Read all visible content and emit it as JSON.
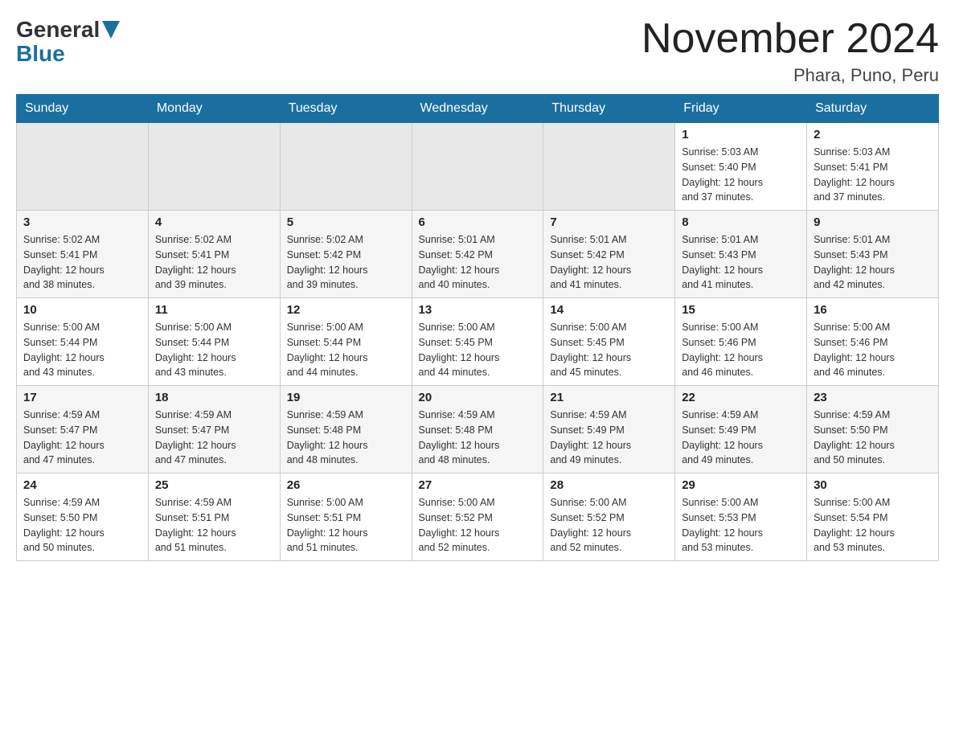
{
  "logo": {
    "text_general": "General",
    "text_blue": "Blue"
  },
  "title": "November 2024",
  "subtitle": "Phara, Puno, Peru",
  "days_of_week": [
    "Sunday",
    "Monday",
    "Tuesday",
    "Wednesday",
    "Thursday",
    "Friday",
    "Saturday"
  ],
  "weeks": [
    [
      {
        "day": "",
        "info": ""
      },
      {
        "day": "",
        "info": ""
      },
      {
        "day": "",
        "info": ""
      },
      {
        "day": "",
        "info": ""
      },
      {
        "day": "",
        "info": ""
      },
      {
        "day": "1",
        "info": "Sunrise: 5:03 AM\nSunset: 5:40 PM\nDaylight: 12 hours\nand 37 minutes."
      },
      {
        "day": "2",
        "info": "Sunrise: 5:03 AM\nSunset: 5:41 PM\nDaylight: 12 hours\nand 37 minutes."
      }
    ],
    [
      {
        "day": "3",
        "info": "Sunrise: 5:02 AM\nSunset: 5:41 PM\nDaylight: 12 hours\nand 38 minutes."
      },
      {
        "day": "4",
        "info": "Sunrise: 5:02 AM\nSunset: 5:41 PM\nDaylight: 12 hours\nand 39 minutes."
      },
      {
        "day": "5",
        "info": "Sunrise: 5:02 AM\nSunset: 5:42 PM\nDaylight: 12 hours\nand 39 minutes."
      },
      {
        "day": "6",
        "info": "Sunrise: 5:01 AM\nSunset: 5:42 PM\nDaylight: 12 hours\nand 40 minutes."
      },
      {
        "day": "7",
        "info": "Sunrise: 5:01 AM\nSunset: 5:42 PM\nDaylight: 12 hours\nand 41 minutes."
      },
      {
        "day": "8",
        "info": "Sunrise: 5:01 AM\nSunset: 5:43 PM\nDaylight: 12 hours\nand 41 minutes."
      },
      {
        "day": "9",
        "info": "Sunrise: 5:01 AM\nSunset: 5:43 PM\nDaylight: 12 hours\nand 42 minutes."
      }
    ],
    [
      {
        "day": "10",
        "info": "Sunrise: 5:00 AM\nSunset: 5:44 PM\nDaylight: 12 hours\nand 43 minutes."
      },
      {
        "day": "11",
        "info": "Sunrise: 5:00 AM\nSunset: 5:44 PM\nDaylight: 12 hours\nand 43 minutes."
      },
      {
        "day": "12",
        "info": "Sunrise: 5:00 AM\nSunset: 5:44 PM\nDaylight: 12 hours\nand 44 minutes."
      },
      {
        "day": "13",
        "info": "Sunrise: 5:00 AM\nSunset: 5:45 PM\nDaylight: 12 hours\nand 44 minutes."
      },
      {
        "day": "14",
        "info": "Sunrise: 5:00 AM\nSunset: 5:45 PM\nDaylight: 12 hours\nand 45 minutes."
      },
      {
        "day": "15",
        "info": "Sunrise: 5:00 AM\nSunset: 5:46 PM\nDaylight: 12 hours\nand 46 minutes."
      },
      {
        "day": "16",
        "info": "Sunrise: 5:00 AM\nSunset: 5:46 PM\nDaylight: 12 hours\nand 46 minutes."
      }
    ],
    [
      {
        "day": "17",
        "info": "Sunrise: 4:59 AM\nSunset: 5:47 PM\nDaylight: 12 hours\nand 47 minutes."
      },
      {
        "day": "18",
        "info": "Sunrise: 4:59 AM\nSunset: 5:47 PM\nDaylight: 12 hours\nand 47 minutes."
      },
      {
        "day": "19",
        "info": "Sunrise: 4:59 AM\nSunset: 5:48 PM\nDaylight: 12 hours\nand 48 minutes."
      },
      {
        "day": "20",
        "info": "Sunrise: 4:59 AM\nSunset: 5:48 PM\nDaylight: 12 hours\nand 48 minutes."
      },
      {
        "day": "21",
        "info": "Sunrise: 4:59 AM\nSunset: 5:49 PM\nDaylight: 12 hours\nand 49 minutes."
      },
      {
        "day": "22",
        "info": "Sunrise: 4:59 AM\nSunset: 5:49 PM\nDaylight: 12 hours\nand 49 minutes."
      },
      {
        "day": "23",
        "info": "Sunrise: 4:59 AM\nSunset: 5:50 PM\nDaylight: 12 hours\nand 50 minutes."
      }
    ],
    [
      {
        "day": "24",
        "info": "Sunrise: 4:59 AM\nSunset: 5:50 PM\nDaylight: 12 hours\nand 50 minutes."
      },
      {
        "day": "25",
        "info": "Sunrise: 4:59 AM\nSunset: 5:51 PM\nDaylight: 12 hours\nand 51 minutes."
      },
      {
        "day": "26",
        "info": "Sunrise: 5:00 AM\nSunset: 5:51 PM\nDaylight: 12 hours\nand 51 minutes."
      },
      {
        "day": "27",
        "info": "Sunrise: 5:00 AM\nSunset: 5:52 PM\nDaylight: 12 hours\nand 52 minutes."
      },
      {
        "day": "28",
        "info": "Sunrise: 5:00 AM\nSunset: 5:52 PM\nDaylight: 12 hours\nand 52 minutes."
      },
      {
        "day": "29",
        "info": "Sunrise: 5:00 AM\nSunset: 5:53 PM\nDaylight: 12 hours\nand 53 minutes."
      },
      {
        "day": "30",
        "info": "Sunrise: 5:00 AM\nSunset: 5:54 PM\nDaylight: 12 hours\nand 53 minutes."
      }
    ]
  ]
}
